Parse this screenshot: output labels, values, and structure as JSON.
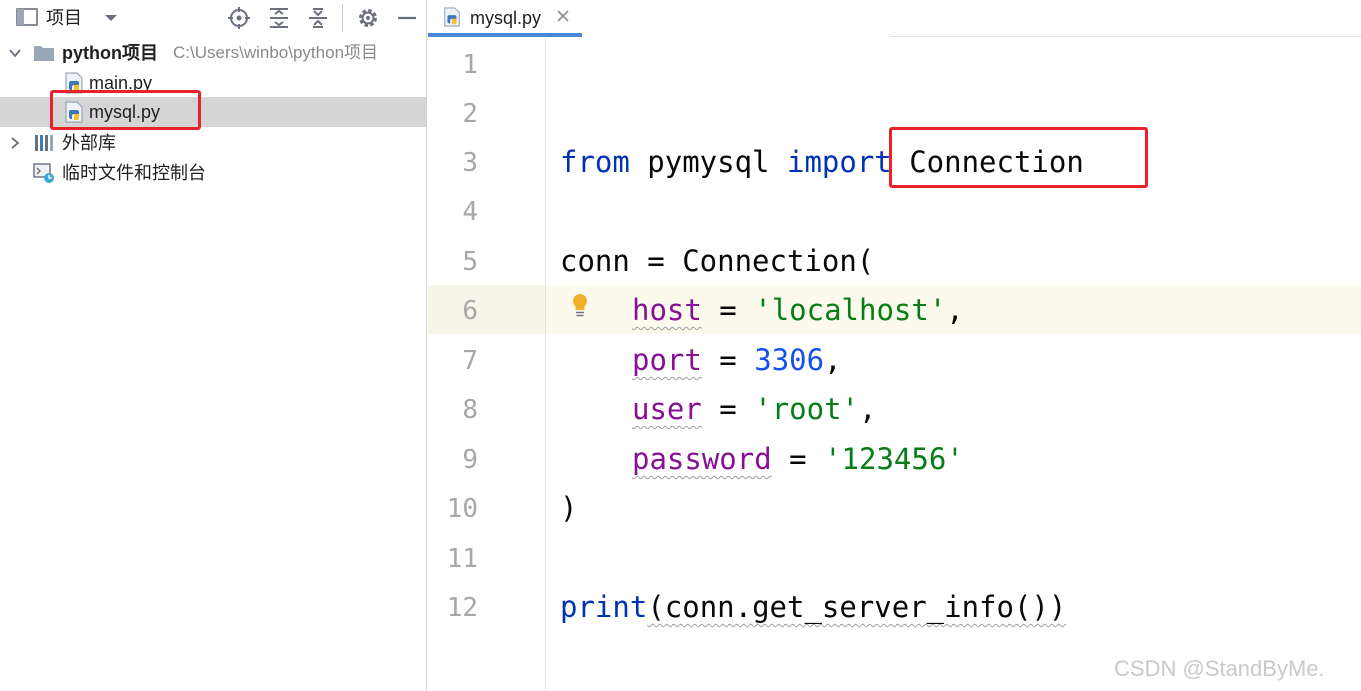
{
  "project_panel": {
    "title": "项目",
    "tree": {
      "project_name": "python项目",
      "project_path": "C:\\Users\\winbo\\python项目",
      "files": [
        "main.py",
        "mysql.py"
      ],
      "external_libraries": "外部库",
      "scratches": "临时文件和控制台"
    }
  },
  "editor": {
    "tab_label": "mysql.py",
    "line_numbers": [
      "1",
      "2",
      "3",
      "4",
      "5",
      "6",
      "7",
      "8",
      "9",
      "10",
      "11",
      "12"
    ],
    "current_line": 6,
    "code": {
      "l3_kw_from": "from",
      "l3_module": " pymysql ",
      "l3_kw_import": "import",
      "l3_name": " Connection",
      "l5": "conn = Connection(",
      "l6_param": "host",
      "l6_eq": " = ",
      "l6_value": "'localhost'",
      "l6_end": ",",
      "l7_param": "port",
      "l7_eq": " = ",
      "l7_value": "3306",
      "l7_end": ",",
      "l8_param": "user",
      "l8_eq": " = ",
      "l8_value": "'root'",
      "l8_end": ",",
      "l9_param": "password",
      "l9_eq": " = ",
      "l9_value": "'123456'",
      "l10": ")",
      "l12_fn": "print",
      "l12_rest": "(conn.get_server_info())"
    }
  },
  "watermark": "CSDN @StandByMe.",
  "colors": {
    "highlight_box": "#e8212b",
    "keyword": "#0033b3",
    "parameter": "#871094",
    "string": "#067d17",
    "number": "#1750eb",
    "tab_underline": "#4a87d6",
    "selected_row": "#d5d5d5"
  },
  "icons": [
    "project-view-icon",
    "dropdown-arrow-icon",
    "locate-icon",
    "expand-all-icon",
    "collapse-all-icon",
    "gear-icon",
    "minimize-icon",
    "folder-icon",
    "python-file-icon",
    "library-icon",
    "scratch-console-icon",
    "close-icon",
    "lightbulb-icon"
  ]
}
